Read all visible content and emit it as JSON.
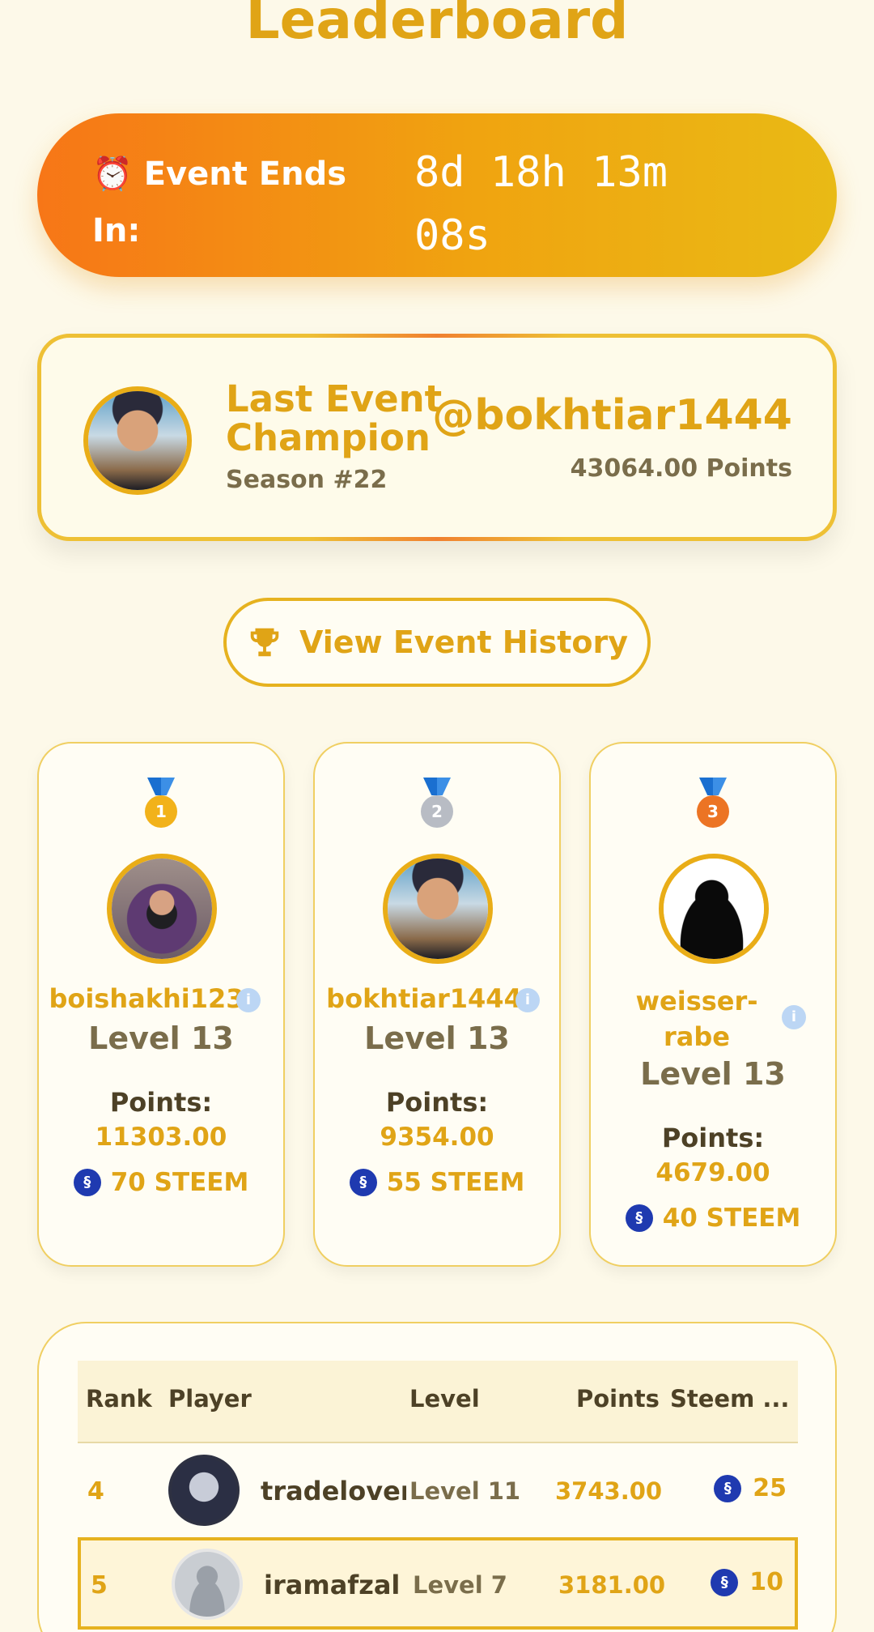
{
  "page": {
    "title": "Leaderboard"
  },
  "timer": {
    "label_line1": "⏰ Event Ends",
    "label_line2": "In:",
    "value_line1": "8d 18h 13m",
    "value_line2": "08s"
  },
  "champion": {
    "title_line1": "Last Event",
    "title_line2": "Champion",
    "season": "Season #22",
    "username": "@bokhtiar1444",
    "points": "43064.00 Points"
  },
  "history_button": {
    "label": "View Event History"
  },
  "podium": [
    {
      "medal": "1",
      "username": "boishakhi123",
      "level": "Level 13",
      "points_label": "Points:",
      "points": "11303.00",
      "reward": "70 STEEM"
    },
    {
      "medal": "2",
      "username": "bokhtiar1444",
      "level": "Level 13",
      "points_label": "Points:",
      "points": "9354.00",
      "reward": "55 STEEM"
    },
    {
      "medal": "3",
      "username_line1": "weisser-",
      "username_line2": "rabe",
      "level": "Level 13",
      "points_label": "Points:",
      "points": "4679.00",
      "reward": "40 STEEM"
    }
  ],
  "table": {
    "headers": {
      "rank": "Rank",
      "player": "Player",
      "level": "Level",
      "points": "Points",
      "steem": "Steem ..."
    },
    "rows": [
      {
        "rank": "4",
        "player": "tradelover",
        "level": "Level 11",
        "points": "3743.00",
        "steem": "25"
      },
      {
        "rank": "5",
        "player": "iramafzal",
        "level": "Level 7",
        "points": "3181.00",
        "steem": "10"
      }
    ]
  },
  "colors": {
    "accent": "#e0a416",
    "background": "#fdf9e9",
    "timer_start": "#f77617",
    "timer_end": "#e9ba15",
    "steem": "#1f3ab0"
  },
  "icons": {
    "timer": "alarm-clock-icon",
    "history": "trophy-icon",
    "info": "info-icon",
    "currency": "steem-icon"
  }
}
